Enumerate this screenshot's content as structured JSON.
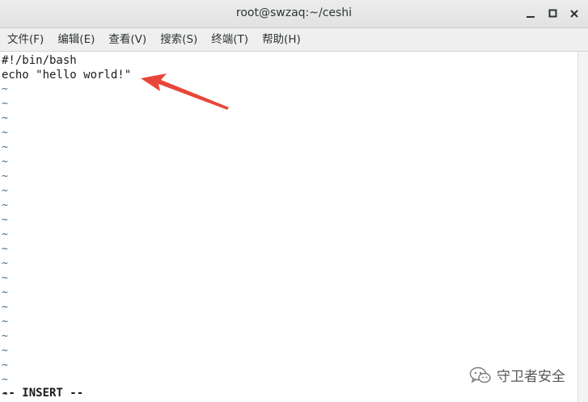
{
  "window": {
    "title": "root@swzaq:~/ceshi"
  },
  "controls": {
    "minimize_icon": "minimize-icon",
    "maximize_icon": "maximize-icon",
    "close_icon": "close-icon"
  },
  "menu": {
    "items": [
      {
        "label": "文件(F)"
      },
      {
        "label": "编辑(E)"
      },
      {
        "label": "查看(V)"
      },
      {
        "label": "搜索(S)"
      },
      {
        "label": "终端(T)"
      },
      {
        "label": "帮助(H)"
      }
    ]
  },
  "editor": {
    "lines": [
      "#!/bin/bash",
      "echo \"hello world!\""
    ],
    "empty_line_marker": "~",
    "status": "-- INSERT --"
  },
  "annotation": {
    "color": "#e8463a"
  },
  "watermark": {
    "text": "守卫者安全",
    "icon": "wechat-icon"
  }
}
